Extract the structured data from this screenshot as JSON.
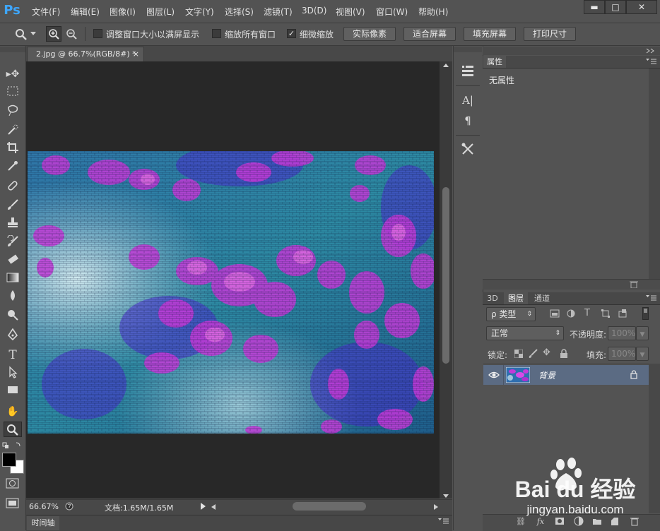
{
  "app": {
    "logo": "Ps"
  },
  "menu": [
    "文件(F)",
    "编辑(E)",
    "图像(I)",
    "图层(L)",
    "文字(Y)",
    "选择(S)",
    "滤镜(T)",
    "3D(D)",
    "视图(V)",
    "窗口(W)",
    "帮助(H)"
  ],
  "window_controls": {
    "minimize": "▬",
    "maximize": "□",
    "close": "✕"
  },
  "options_bar": {
    "checkboxes": [
      {
        "label": "调整窗口大小以满屏显示",
        "checked": false,
        "mark": ""
      },
      {
        "label": "缩放所有窗口",
        "checked": false,
        "mark": ""
      },
      {
        "label": "细微缩放",
        "checked": true,
        "mark": "✓"
      }
    ],
    "buttons": [
      "实际像素",
      "适合屏幕",
      "填充屏幕",
      "打印尺寸"
    ]
  },
  "document": {
    "tab_title": "2.jpg @ 66.7%(RGB/8#) *",
    "tab_close": "×",
    "zoom": "66.67%",
    "doc_info": "文档:1.65M/1.65M"
  },
  "timeline": {
    "label": "时间轴"
  },
  "properties": {
    "tab": "属性",
    "body": "无属性"
  },
  "layers": {
    "tabs": [
      "3D",
      "图层",
      "通道"
    ],
    "filter_label": "ρ 类型",
    "blend_mode": "正常",
    "opacity_label": "不透明度:",
    "opacity_value": "100%",
    "lock_label": "锁定:",
    "fill_label": "填充:",
    "fill_value": "100%",
    "items": [
      {
        "name": "背景",
        "visible": true,
        "locked": true
      }
    ]
  },
  "watermark": {
    "brand": "Bai du 经验",
    "url": "jingyan.baidu.com"
  },
  "colors": {
    "accent": "#3ea6ff",
    "selection": "#5b6b83",
    "canvas": "#282828",
    "ui": "#535353"
  },
  "icons": [
    "zoom-icon",
    "zoom-in-icon",
    "zoom-out-icon",
    "move-tool-icon",
    "marquee-icon",
    "lasso-icon",
    "quick-select-icon",
    "crop-icon",
    "eyedropper-icon",
    "healing-icon",
    "brush-icon",
    "stamp-icon",
    "history-brush-icon",
    "eraser-icon",
    "gradient-icon",
    "blur-icon",
    "dodge-icon",
    "pen-icon",
    "type-icon",
    "path-select-icon",
    "shape-icon",
    "hand-icon",
    "zoom-tool-icon",
    "eye-icon",
    "lock-icon"
  ]
}
